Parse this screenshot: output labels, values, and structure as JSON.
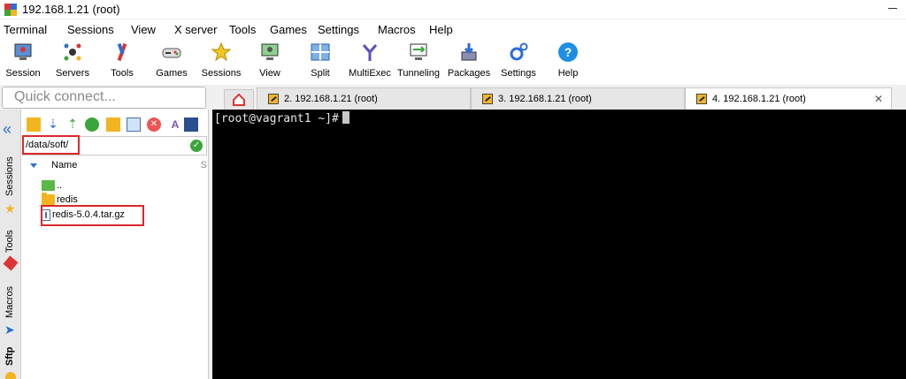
{
  "window": {
    "title": "192.168.1.21 (root)"
  },
  "menu": [
    "Terminal",
    "Sessions",
    "View",
    "X server",
    "Tools",
    "Games",
    "Settings",
    "Macros",
    "Help"
  ],
  "toolbar": [
    {
      "label": "Session",
      "icon": "session-icon"
    },
    {
      "label": "Servers",
      "icon": "servers-icon"
    },
    {
      "label": "Tools",
      "icon": "tools-icon"
    },
    {
      "label": "Games",
      "icon": "games-icon"
    },
    {
      "label": "Sessions",
      "icon": "sessions-star-icon"
    },
    {
      "label": "View",
      "icon": "view-icon"
    },
    {
      "label": "Split",
      "icon": "split-icon"
    },
    {
      "label": "MultiExec",
      "icon": "multiexec-icon"
    },
    {
      "label": "Tunneling",
      "icon": "tunneling-icon"
    },
    {
      "label": "Packages",
      "icon": "packages-icon"
    },
    {
      "label": "Settings",
      "icon": "settings-icon"
    },
    {
      "label": "Help",
      "icon": "help-icon"
    }
  ],
  "quick_connect": {
    "placeholder": "Quick connect..."
  },
  "tabs": [
    {
      "label": "2. 192.168.1.21 (root)"
    },
    {
      "label": "3. 192.168.1.21 (root)"
    },
    {
      "label": "4. 192.168.1.21 (root)",
      "active": true
    }
  ],
  "side_tabs": [
    "Sessions",
    "Tools",
    "Macros",
    "Sftp"
  ],
  "sftp": {
    "path": "/data/soft/",
    "column_name": "Name",
    "files": [
      {
        "name": "..",
        "type": "parent"
      },
      {
        "name": "redis",
        "type": "folder"
      },
      {
        "name": "redis-5.0.4.tar.gz",
        "type": "file"
      }
    ]
  },
  "terminal": {
    "prompt": "[root@vagrant1 ~]#"
  },
  "colors": {
    "terminal_bg": "#000000",
    "highlight": "#d9282b",
    "folder": "#f2b520"
  }
}
